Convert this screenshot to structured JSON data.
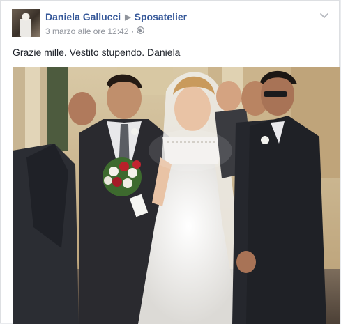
{
  "post": {
    "author": "Daniela Gallucci",
    "page": "Sposatelier",
    "timestamp": "3 marzo alle ore 12:42",
    "separator": "·",
    "audience_icon": "globe-icon",
    "menu_icon": "chevron-down-icon",
    "text": "Grazie mille. Vestito stupendo. Daniela",
    "photo_description_icon": "wedding-photo"
  },
  "colors": {
    "link": "#365899",
    "meta": "#90949c",
    "text": "#1d2129",
    "background": "#e9ebee"
  }
}
